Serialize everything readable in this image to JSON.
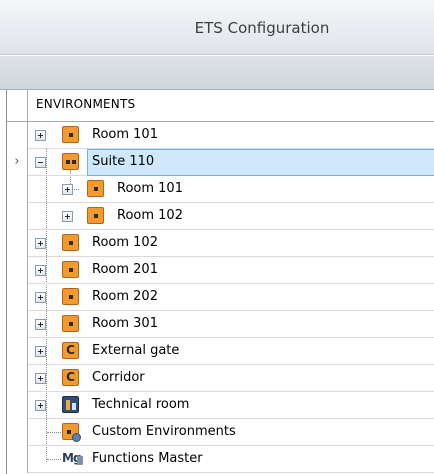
{
  "window": {
    "title": "ETS Configuration"
  },
  "grid": {
    "column_header": "ENVIRONMENTS",
    "row_indicator_glyph": "›",
    "rows": [
      {
        "label": "Room 101",
        "icon": "room-icon",
        "expander": "plus",
        "depth": 0
      },
      {
        "label": "Suite 110",
        "icon": "suite-icon",
        "expander": "minus",
        "depth": 0,
        "selected": true
      },
      {
        "label": "Room 101",
        "icon": "room-icon",
        "expander": "plus",
        "depth": 1
      },
      {
        "label": "Room 102",
        "icon": "room-icon",
        "expander": "plus",
        "depth": 1
      },
      {
        "label": "Room 102",
        "icon": "room-icon",
        "expander": "plus",
        "depth": 0
      },
      {
        "label": "Room 201",
        "icon": "room-icon",
        "expander": "plus",
        "depth": 0
      },
      {
        "label": "Room 202",
        "icon": "room-icon",
        "expander": "plus",
        "depth": 0
      },
      {
        "label": "Room 301",
        "icon": "room-icon",
        "expander": "plus",
        "depth": 0
      },
      {
        "label": "External gate",
        "icon": "common-area-icon",
        "expander": "plus",
        "depth": 0
      },
      {
        "label": "Corridor",
        "icon": "common-area-icon",
        "expander": "plus",
        "depth": 0
      },
      {
        "label": "Technical room",
        "icon": "technical-room-icon",
        "expander": "plus",
        "depth": 0
      },
      {
        "label": "Custom Environments",
        "icon": "custom-environment-icon",
        "expander": "none",
        "depth": 0
      },
      {
        "label": "Functions Master",
        "icon": "functions-master-icon",
        "expander": "none",
        "depth": 0
      }
    ]
  },
  "icons": {
    "common_area_letter": "C",
    "functions_master_letters": "Mg"
  },
  "colors": {
    "selection_fill": "#cfe8fb",
    "selection_border": "#6fb3ea",
    "environment_icon": "#f29a2f"
  }
}
